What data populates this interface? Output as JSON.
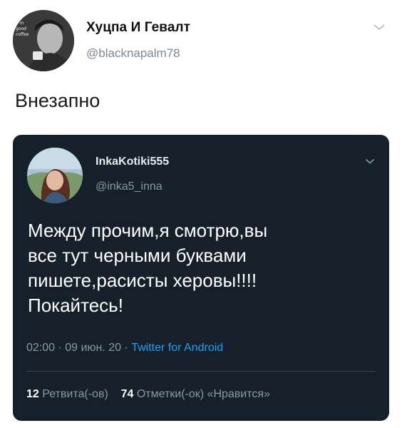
{
  "outer_tweet": {
    "avatar_icon": "profile-photo",
    "avatar_text": "I'm good coffee",
    "display_name": "Хуцпа И Гевалт",
    "handle": "@blacknapalm78",
    "text": "Внезапно",
    "menu_icon": "chevron-down-icon"
  },
  "embedded_tweet": {
    "avatar_icon": "profile-photo",
    "display_name": "InkaKotiki555",
    "handle": "@inka5_inna",
    "menu_icon": "chevron-down-icon",
    "text": "Между прочим,я смотрю,вы\nвсе тут черными буквами\nпишете,расисты херовы!!!!\nПокайтесь!",
    "time": "02:00",
    "date": "09 июн. 20",
    "separator": "·",
    "source": "Twitter for Android",
    "retweets_count": "12",
    "retweets_label": "Ретвита(-ов)",
    "likes_count": "74",
    "likes_label": "Отметки(-ок) «Нравится»"
  },
  "colors": {
    "card_bg": "#15202b",
    "accent": "#1da1f2",
    "muted": "#8899a6"
  }
}
